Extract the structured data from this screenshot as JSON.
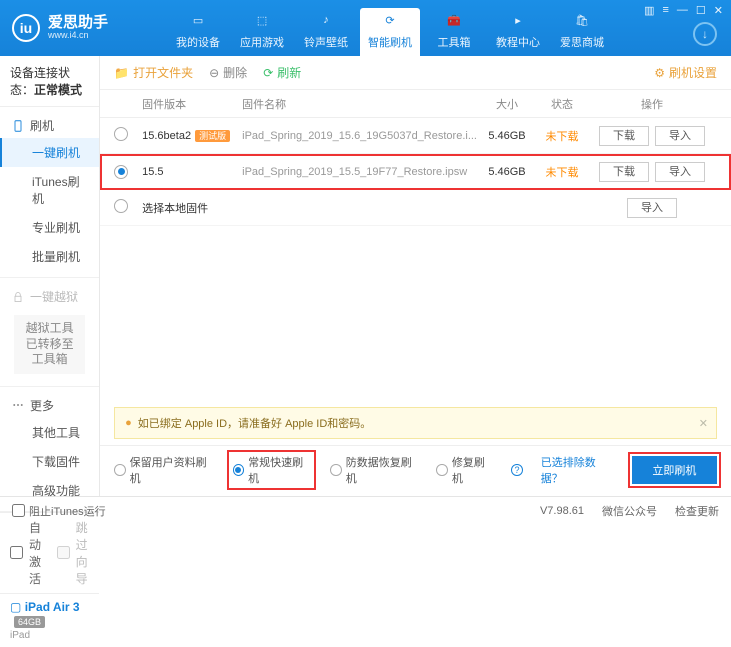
{
  "header": {
    "title": "爱思助手",
    "subtitle": "www.i4.cn",
    "nav": [
      "我的设备",
      "应用游戏",
      "铃声壁纸",
      "智能刷机",
      "工具箱",
      "教程中心",
      "爱思商城"
    ],
    "active_nav": 3
  },
  "sidebar": {
    "conn_label": "设备连接状态：",
    "conn_mode": "正常模式",
    "groups": {
      "flash": {
        "head": "刷机",
        "items": [
          "一键刷机",
          "iTunes刷机",
          "专业刷机",
          "批量刷机"
        ],
        "active": 0
      },
      "jailbreak": {
        "head": "一键越狱",
        "note": "越狱工具已转移至工具箱"
      },
      "more": {
        "head": "更多",
        "items": [
          "其他工具",
          "下载固件",
          "高级功能"
        ]
      }
    },
    "auto_activate": "自动激活",
    "skip_guide": "跳过向导",
    "device": {
      "name": "iPad Air 3",
      "storage": "64GB",
      "type": "iPad"
    }
  },
  "toolbar": {
    "open_folder": "打开文件夹",
    "delete": "删除",
    "refresh": "刷新",
    "settings": "刷机设置"
  },
  "table": {
    "headers": {
      "version": "固件版本",
      "name": "固件名称",
      "size": "大小",
      "state": "状态",
      "ops": "操作"
    },
    "download_btn": "下载",
    "import_btn": "导入",
    "rows": [
      {
        "version": "15.6beta2",
        "badge": "测试版",
        "name": "iPad_Spring_2019_15.6_19G5037d_Restore.i...",
        "size": "5.46GB",
        "state": "未下载",
        "selected": false
      },
      {
        "version": "15.5",
        "badge": "",
        "name": "iPad_Spring_2019_15.5_19F77_Restore.ipsw",
        "size": "5.46GB",
        "state": "未下载",
        "selected": true
      }
    ],
    "local_fw": "选择本地固件"
  },
  "warning": "如已绑定 Apple ID，请准备好 Apple ID和密码。",
  "options": {
    "keep_data": "保留用户资料刷机",
    "normal": "常规快速刷机",
    "antirecovery": "防数据恢复刷机",
    "repair": "修复刷机",
    "exclude_link": "已选排除数据？",
    "flash_btn": "立即刷机"
  },
  "statusbar": {
    "block_itunes": "阻止iTunes运行",
    "version": "V7.98.61",
    "wechat": "微信公众号",
    "check_update": "检查更新"
  }
}
